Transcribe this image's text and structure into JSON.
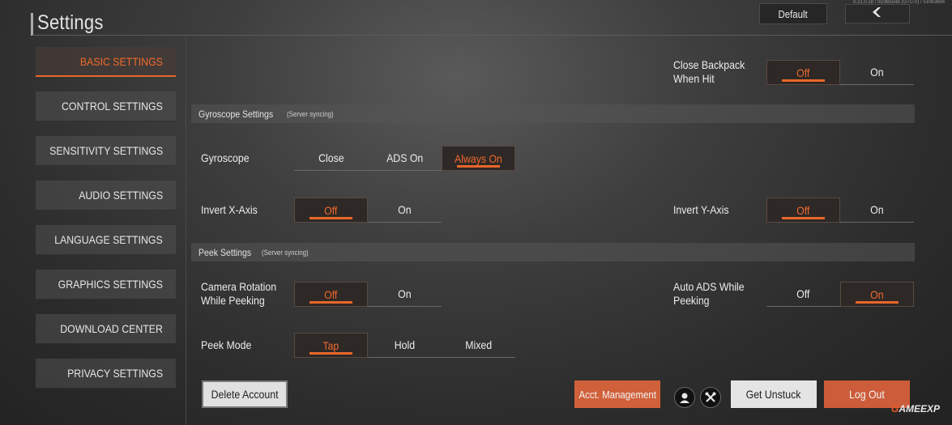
{
  "header": {
    "title": "Settings",
    "version": "0.21.0.18 / 0D365548 (GTC-0) / 51063694",
    "default_label": "Default",
    "back_icon": "chevron-left-icon"
  },
  "sidebar": {
    "items": [
      {
        "label": "BASIC SETTINGS",
        "active": true
      },
      {
        "label": "CONTROL SETTINGS",
        "active": false
      },
      {
        "label": "SENSITIVITY SETTINGS",
        "active": false
      },
      {
        "label": "AUDIO SETTINGS",
        "active": false
      },
      {
        "label": "LANGUAGE SETTINGS",
        "active": false
      },
      {
        "label": "GRAPHICS SETTINGS",
        "active": false
      },
      {
        "label": "DOWNLOAD CENTER",
        "active": false
      },
      {
        "label": "PRIVACY SETTINGS",
        "active": false
      }
    ]
  },
  "close_backpack": {
    "label_line1": "Close Backpack",
    "label_line2": "When Hit",
    "options": [
      "Off",
      "On"
    ],
    "selected": "Off"
  },
  "gyro_section": {
    "title": "Gyroscope Settings",
    "subtitle": "(Server syncing)"
  },
  "gyroscope": {
    "label": "Gyroscope",
    "options": [
      "Close",
      "ADS On",
      "Always On"
    ],
    "selected": "Always On"
  },
  "invert_x": {
    "label": "Invert X-Axis",
    "options": [
      "Off",
      "On"
    ],
    "selected": "Off"
  },
  "invert_y": {
    "label": "Invert Y-Axis",
    "options": [
      "Off",
      "On"
    ],
    "selected": "Off"
  },
  "peek_section": {
    "title": "Peek Settings",
    "subtitle": "(Server syncing)"
  },
  "camera_rotation": {
    "label_line1": "Camera Rotation",
    "label_line2": "While Peeking",
    "options": [
      "Off",
      "On"
    ],
    "selected": "Off"
  },
  "auto_ads": {
    "label_line1": "Auto ADS While",
    "label_line2": "Peeking",
    "options": [
      "Off",
      "On"
    ],
    "selected": "On"
  },
  "peek_mode": {
    "label": "Peek Mode",
    "options": [
      "Tap",
      "Hold",
      "Mixed"
    ],
    "selected": "Tap"
  },
  "footer": {
    "delete_account": "Delete Account",
    "acct_management": "Acct. Management",
    "icon1": "support-agent-icon",
    "icon2": "tools-icon",
    "get_unstuck": "Get Unstuck",
    "log_out": "Log Out"
  },
  "watermark": {
    "part1": "G",
    "part2": "AMEEXP"
  },
  "colors": {
    "accent": "#e8672a",
    "accent_button": "#d0603a"
  }
}
